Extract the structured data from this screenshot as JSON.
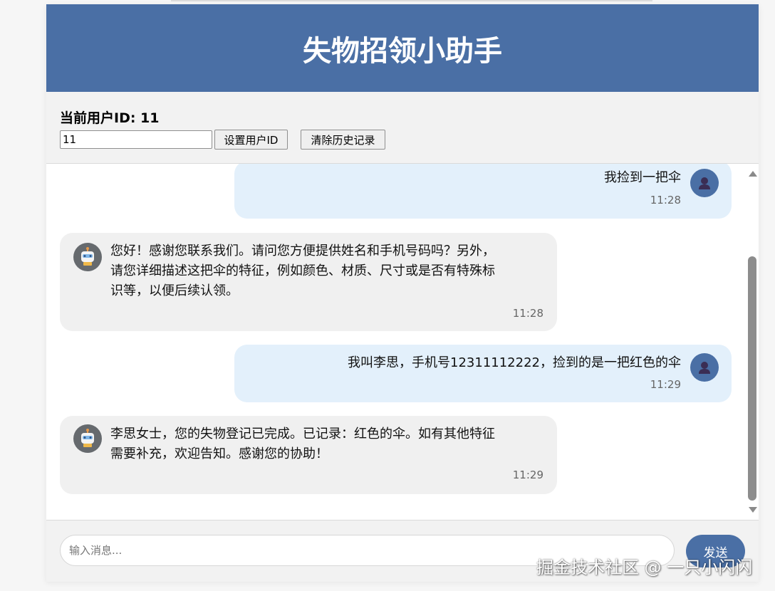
{
  "header": {
    "title": "失物招领小助手"
  },
  "user_panel": {
    "label": "当前用户ID: 11",
    "id_value": "11",
    "set_button": "设置用户ID",
    "clear_button": "清除历史记录"
  },
  "messages": [
    {
      "role": "user",
      "text": "我捡到一把伞",
      "time": "11:28",
      "avatar": "user-avatar-icon"
    },
    {
      "role": "bot",
      "lines": [
        "您好！感谢您联系我们。请问您方便提供姓名和手机号码吗？另外，",
        "请您详细描述这把伞的特征，例如颜色、材质、尺寸或是否有特殊标",
        "识等，以便后续认领。"
      ],
      "time": "11:28",
      "avatar": "robot-avatar-icon"
    },
    {
      "role": "user",
      "text": "我叫李思，手机号12311112222，捡到的是一把红色的伞",
      "time": "11:29",
      "avatar": "user-avatar-icon"
    },
    {
      "role": "bot",
      "lines": [
        "李思女士，您的失物登记已完成。已记录：红色的伞。如有其他特征",
        "需要补充，欢迎告知。感谢您的协助！"
      ],
      "time": "11:29",
      "avatar": "robot-avatar-icon"
    }
  ],
  "composer": {
    "placeholder": "输入消息...",
    "send_button": "发送"
  },
  "watermark": "掘金技术社区 @ 一只小闪闪",
  "colors": {
    "header_bg": "#4a6fa5",
    "user_bubble": "#e3f0fb",
    "bot_bubble": "#f0f0f0",
    "send_button": "#4a6fa5"
  }
}
